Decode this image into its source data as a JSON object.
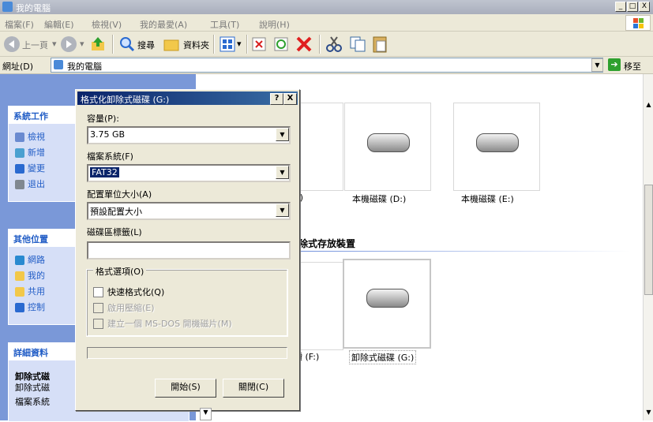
{
  "window": {
    "title": "我的電腦",
    "min": "_",
    "max": "□",
    "close": "X"
  },
  "menu": [
    "檔案(F)",
    "編輯(E)",
    "檢視(V)",
    "我的最愛(A)",
    "工具(T)",
    "說明(H)"
  ],
  "toolbar": {
    "back": "上一頁",
    "search": "搜尋",
    "folders": "資料夾"
  },
  "address": {
    "label": "網址(D)",
    "value": "我的電腦",
    "go": "移至"
  },
  "left_panels": {
    "tasks": {
      "title": "系統工作",
      "items": [
        "檢視",
        "新增",
        "變更",
        "退出"
      ]
    },
    "other": {
      "title": "其他位置",
      "items": [
        "網路",
        "我的",
        "共用",
        "控制"
      ]
    },
    "details": {
      "title": "詳細資料",
      "name": "卸除式磁",
      "type": "卸除式磁",
      "fs": "檔案系統"
    }
  },
  "main": {
    "drives": {
      "c_suffix": ":)",
      "d": "本機磁碟 (D:)",
      "e": "本機磁碟 (E:)"
    },
    "removable_header": "除式存放裝置",
    "removable": {
      "f_suffix": "讚 (F:)",
      "g": "卸除式磁碟 (G:)"
    }
  },
  "dialog": {
    "title": "格式化卸除式磁碟 (G:)",
    "help": "?",
    "close": "X",
    "capacity_label": "容量(P):",
    "capacity_value": "3.75 GB",
    "fs_label": "檔案系統(F)",
    "fs_value": "FAT32",
    "alloc_label": "配置單位大小(A)",
    "alloc_value": "預設配置大小",
    "volume_label": "磁碟區標籤(L)",
    "volume_value": "",
    "options_title": "格式選項(O)",
    "opt_quick": "快速格式化(Q)",
    "opt_compress": "啟用壓縮(E)",
    "opt_msdos": "建立一個 MS-DOS 開機磁片(M)",
    "start": "開始(S)",
    "close_btn": "關閉(C)"
  },
  "colors": {
    "accent": "#0a246a",
    "panel_bg": "#7a98d8",
    "link": "#215dc6"
  }
}
